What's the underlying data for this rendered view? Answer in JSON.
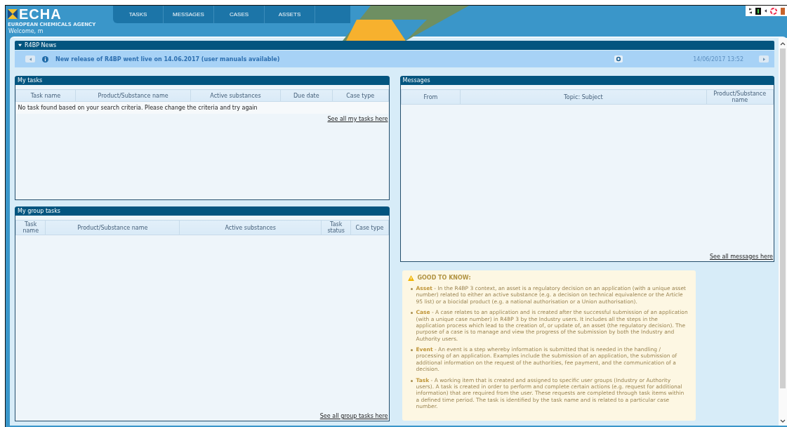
{
  "header": {
    "logo": {
      "name": "ECHA",
      "subtitle": "EUROPEAN CHEMICALS AGENCY"
    },
    "nav": [
      {
        "label": "TASKS",
        "selected": false
      },
      {
        "label": "MESSAGES",
        "selected": false
      },
      {
        "label": "CASES",
        "selected": false
      },
      {
        "label": "ASSETS",
        "selected": false
      }
    ],
    "welcome": "Welcome, m"
  },
  "news": {
    "title": "R4BP News",
    "expanded": true,
    "message": "New release of R4BP went live on 14.06.2017 (user manuals available)",
    "date": "14/06/2017 13:52"
  },
  "my_tasks": {
    "title": "My tasks",
    "columns": [
      "Task name",
      "Product/Substance name",
      "Active substances",
      "Due date",
      "Case type"
    ],
    "empty_message": "No task found based on your search criteria. Please change the criteria and try again",
    "link": "See all my tasks here"
  },
  "group_tasks": {
    "title": "My group tasks",
    "columns": [
      "Task name",
      "Product/Substance name",
      "Active substances",
      "Task status",
      "Case type"
    ],
    "link": "See all group tasks here"
  },
  "messages": {
    "title": "Messages",
    "columns": [
      "From",
      "Topic: Subject",
      "Product/Substance name"
    ],
    "link": "See all messages here"
  },
  "good_to_know": {
    "title": "GOOD TO KNOW:",
    "items": [
      "**Asset** - In the R4BP 3 context, an asset is a regulatory decision on an application (with a unique asset number) related to either an active substance (e.g. a decision on technical equivalence or the Article 95 list) or a biocidal product (e.g. a national authorisation or a Union authorisation).",
      "**Case** - A case relates to an application and is created after the successful submission of an application (with a unique case number) in R4BP 3 by the Industry users. It includes all the steps in the application process which lead to the creation of, or update of, an asset (the regulatory decision). The purpose of a case is to manage and view the progress of the submission by both the Industry and Authority users.",
      "**Event** - An event is a step whereby information is submitted that is needed in the handling / processing of an application. Examples include the submission of an application, the submission of additional information on the request of the authorities, fee payment, and the communication of a decision.",
      "**Task** - A working item that is created and assigned to specific user groups (Industry or Authority users). A task is created in order to perform and complete certain actions (e.g. request for additional information) that are required from the user. These requests are completed through task items within a defined time period. The task is identified by the task name and is related to a particular case number."
    ]
  }
}
